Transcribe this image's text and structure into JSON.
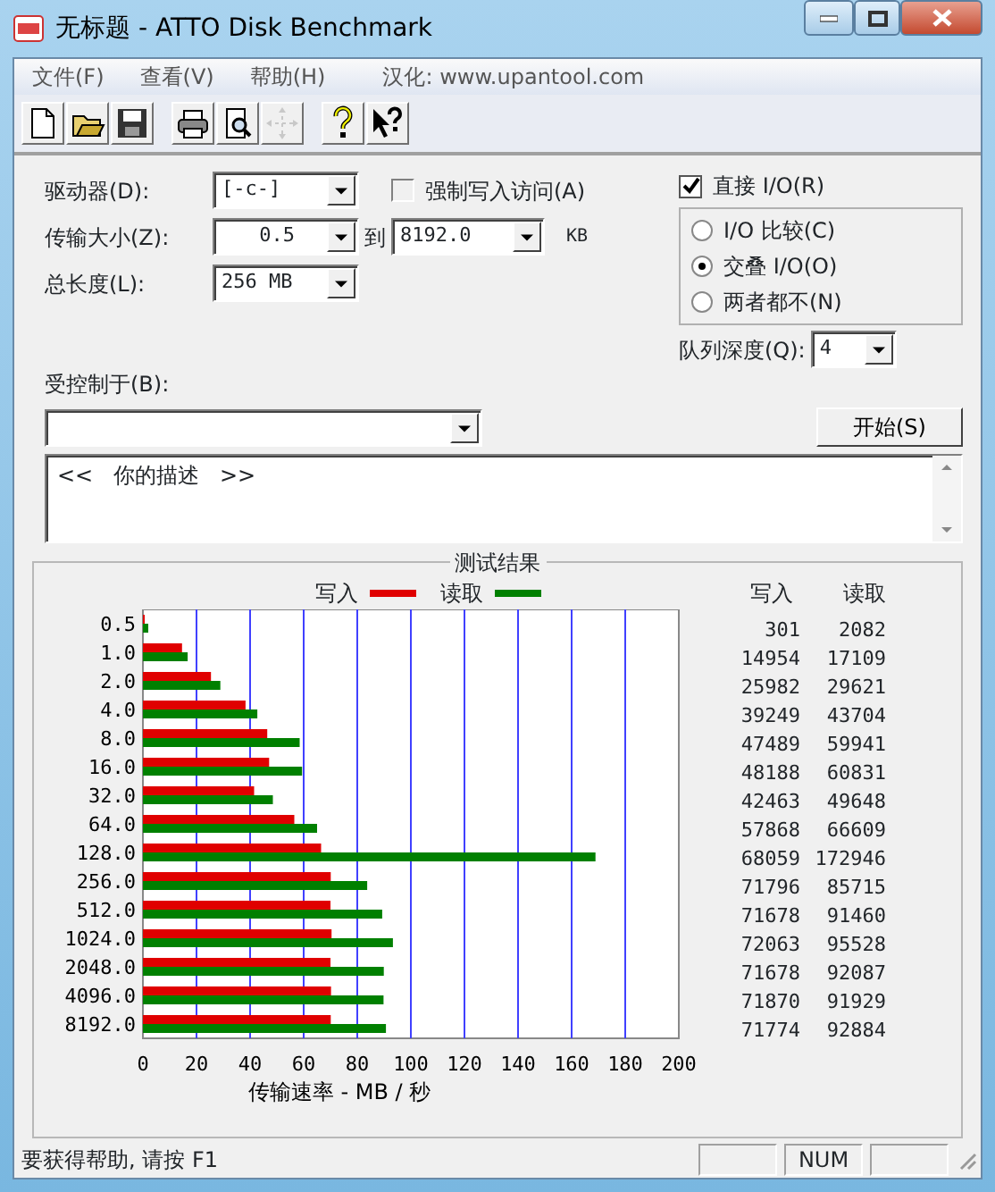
{
  "window": {
    "title": "无标题 - ATTO Disk Benchmark"
  },
  "menu": [
    {
      "label": "文件(F)"
    },
    {
      "label": "查看(V)"
    },
    {
      "label": "帮助(H)"
    },
    {
      "label": "汉化: www.upantool.com"
    }
  ],
  "toolbar": [
    {
      "kind": "new",
      "disabled": false
    },
    {
      "kind": "open",
      "disabled": false
    },
    {
      "kind": "save",
      "disabled": false
    },
    {
      "kind": "print",
      "disabled": false
    },
    {
      "kind": "preview",
      "disabled": false
    },
    {
      "kind": "move",
      "disabled": true
    },
    {
      "kind": "help",
      "disabled": false
    },
    {
      "kind": "context_help",
      "disabled": false
    }
  ],
  "form": {
    "drive": {
      "label": "驱动器(D):",
      "value": "[-c-]"
    },
    "transfer_size": {
      "label": "传输大小(Z):",
      "from": "0.5",
      "to_label": "到",
      "to": "8192.0",
      "unit": "KB"
    },
    "total_length": {
      "label": "总长度(L):",
      "value": "256 MB"
    },
    "force_write": {
      "label": "强制写入访问(A)",
      "checked": false
    },
    "direct_io": {
      "label": "直接 I/O(R)",
      "checked": true
    },
    "io_modes": [
      {
        "label": "I/O 比较(C)",
        "selected": false
      },
      {
        "label": "交叠 I/O(O)",
        "selected": true
      },
      {
        "label": "两者都不(N)",
        "selected": false
      }
    ],
    "queue_depth": {
      "label": "队列深度(Q):",
      "value": "4"
    },
    "controlled_by": {
      "label": "受控制于(B):"
    },
    "start_button": "开始(S)",
    "description": "<<   你的描述   >>"
  },
  "results": {
    "title": "测试结果",
    "columns": [
      "写入",
      "读取"
    ],
    "rows": [
      [
        "301",
        "2082"
      ],
      [
        "14954",
        "17109"
      ],
      [
        "25982",
        "29621"
      ],
      [
        "39249",
        "43704"
      ],
      [
        "47489",
        "59941"
      ],
      [
        "48188",
        "60831"
      ],
      [
        "42463",
        "49648"
      ],
      [
        "57868",
        "66609"
      ],
      [
        "68059",
        "172946"
      ],
      [
        "71796",
        "85715"
      ],
      [
        "71678",
        "91460"
      ],
      [
        "72063",
        "95528"
      ],
      [
        "71678",
        "92087"
      ],
      [
        "71870",
        "91929"
      ],
      [
        "71774",
        "92884"
      ]
    ],
    "chart_data": {
      "type": "bar",
      "orientation": "horizontal",
      "xlabel": "传输速率 - MB / 秒",
      "categories": [
        "0.5",
        "1.0",
        "2.0",
        "4.0",
        "8.0",
        "16.0",
        "32.0",
        "64.0",
        "128.0",
        "256.0",
        "512.0",
        "1024.0",
        "2048.0",
        "4096.0",
        "8192.0"
      ],
      "series": [
        {
          "name": "写入",
          "color": "#e00000",
          "values": [
            0.3,
            14.6,
            25.4,
            38.3,
            46.4,
            47.1,
            41.5,
            56.5,
            66.5,
            70.1,
            70.0,
            70.4,
            70.0,
            70.2,
            70.1
          ]
        },
        {
          "name": "读取",
          "color": "#008000",
          "values": [
            2.0,
            16.7,
            28.9,
            42.7,
            58.5,
            59.4,
            48.5,
            65.0,
            168.9,
            83.7,
            89.3,
            93.3,
            89.9,
            89.8,
            90.7
          ]
        }
      ],
      "xlim": [
        0,
        200
      ],
      "grid": true,
      "xticks": [
        0,
        20,
        40,
        60,
        80,
        100,
        120,
        140,
        160,
        180,
        200
      ]
    }
  },
  "status_bar": {
    "text": "要获得帮助, 请按 F1",
    "panels": [
      {
        "kind": "blank"
      },
      {
        "kind": "text",
        "text": "NUM"
      },
      {
        "kind": "blank"
      }
    ]
  }
}
